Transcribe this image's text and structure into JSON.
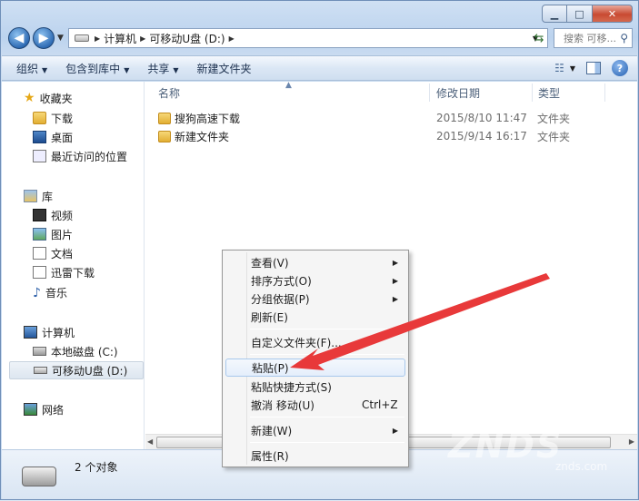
{
  "address": {
    "crumbs": [
      "计算机",
      "可移动U盘 (D:)"
    ],
    "search_placeholder": "搜索 可移..."
  },
  "toolbar": {
    "organize": "组织",
    "include": "包含到库中",
    "share": "共享",
    "new_folder": "新建文件夹"
  },
  "nav": {
    "favorites": "收藏夹",
    "downloads": "下载",
    "desktop": "桌面",
    "recent": "最近访问的位置",
    "library": "库",
    "video": "视频",
    "pictures": "图片",
    "documents": "文档",
    "thunder": "迅雷下载",
    "music": "音乐",
    "computer": "计算机",
    "local_disk": "本地磁盘 (C:)",
    "usb": "可移动U盘 (D:)",
    "network": "网络"
  },
  "columns": {
    "name": "名称",
    "date": "修改日期",
    "type": "类型"
  },
  "files": [
    {
      "name": "搜狗高速下载",
      "date": "2015/8/10 11:47",
      "type": "文件夹"
    },
    {
      "name": "新建文件夹",
      "date": "2015/9/14 16:17",
      "type": "文件夹"
    }
  ],
  "status": {
    "count": "2 个对象"
  },
  "context_menu": {
    "view": "查看(V)",
    "sort": "排序方式(O)",
    "group": "分组依据(P)",
    "refresh": "刷新(E)",
    "customize": "自定义文件夹(F)...",
    "paste": "粘贴(P)",
    "paste_shortcut": "粘贴快捷方式(S)",
    "undo": "撤消 移动(U)",
    "undo_shortcut": "Ctrl+Z",
    "new": "新建(W)",
    "properties": "属性(R)"
  },
  "watermark": {
    "logo": "ZNDS",
    "domain": "znds.com"
  },
  "colors": {
    "annotation_arrow": "#e8393a",
    "accent": "#2f6cb5"
  }
}
